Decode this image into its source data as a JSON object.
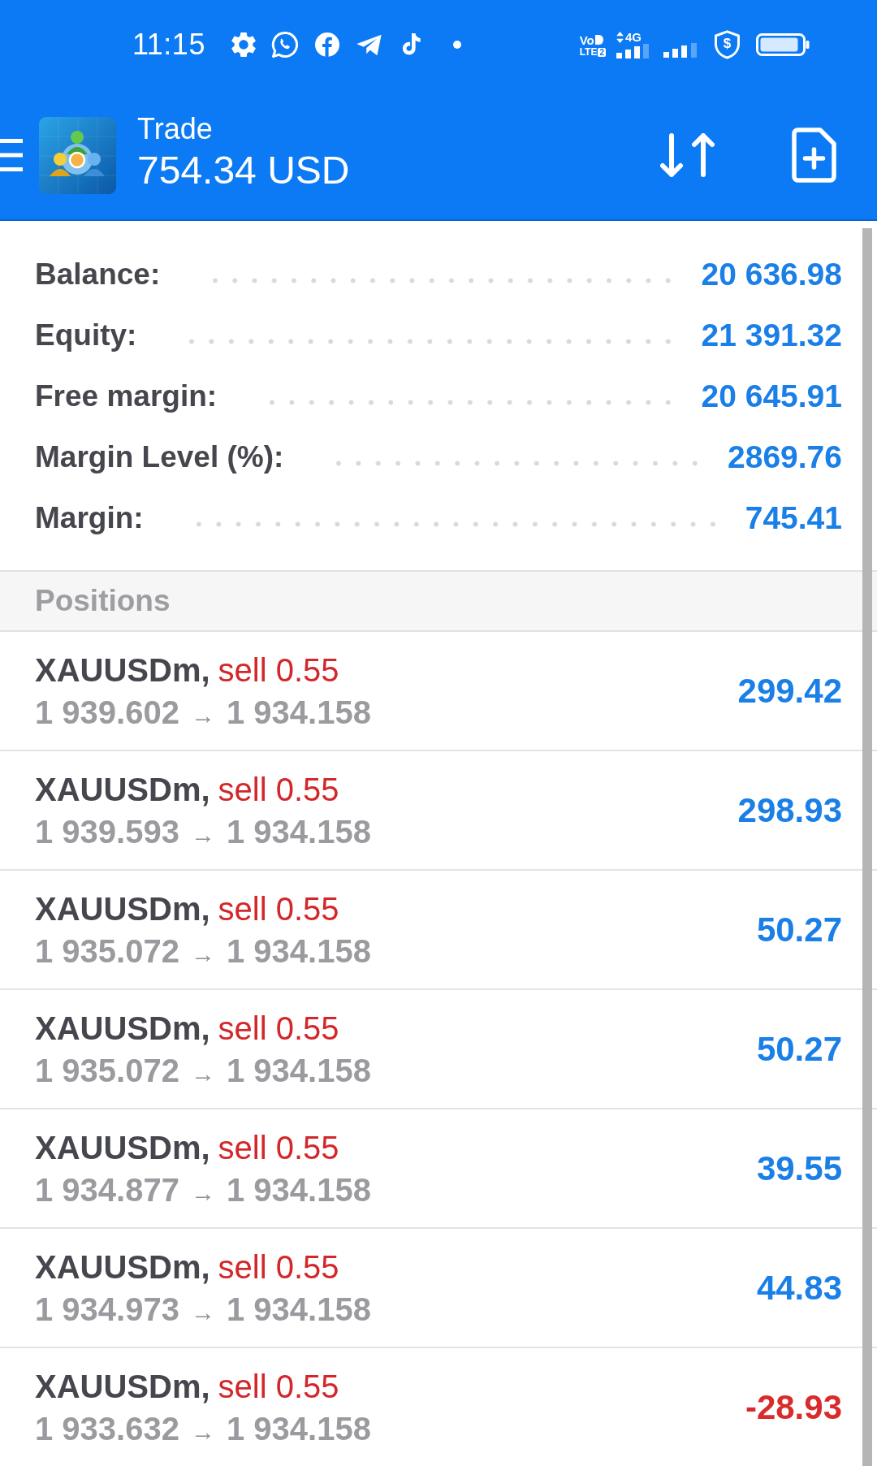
{
  "status_bar": {
    "time": "11:15",
    "volte": {
      "top": "Vo",
      "bottom": "LTE",
      "sim": "2"
    },
    "network_type": "4G",
    "shield_mark": "$"
  },
  "header": {
    "title": "Trade",
    "amount": "754.34 USD"
  },
  "summary": [
    {
      "label": "Balance:",
      "value": "20 636.98"
    },
    {
      "label": "Equity:",
      "value": "21 391.32"
    },
    {
      "label": "Free margin:",
      "value": "20 645.91"
    },
    {
      "label": "Margin Level (%):",
      "value": "2869.76"
    },
    {
      "label": "Margin:",
      "value": "745.41"
    }
  ],
  "positions": {
    "title": "Positions",
    "items": [
      {
        "symbol": "XAUUSDm,",
        "order": "sell 0.55",
        "open_price": "1 939.602",
        "arrow": "→",
        "current_price": "1 934.158",
        "profit": "299.42",
        "color": "#1a7fe6"
      },
      {
        "symbol": "XAUUSDm,",
        "order": "sell 0.55",
        "open_price": "1 939.593",
        "arrow": "→",
        "current_price": "1 934.158",
        "profit": "298.93",
        "color": "#1a7fe6"
      },
      {
        "symbol": "XAUUSDm,",
        "order": "sell 0.55",
        "open_price": "1 935.072",
        "arrow": "→",
        "current_price": "1 934.158",
        "profit": "50.27",
        "color": "#1a7fe6"
      },
      {
        "symbol": "XAUUSDm,",
        "order": "sell 0.55",
        "open_price": "1 935.072",
        "arrow": "→",
        "current_price": "1 934.158",
        "profit": "50.27",
        "color": "#1a7fe6"
      },
      {
        "symbol": "XAUUSDm,",
        "order": "sell 0.55",
        "open_price": "1 934.877",
        "arrow": "→",
        "current_price": "1 934.158",
        "profit": "39.55",
        "color": "#1a7fe6"
      },
      {
        "symbol": "XAUUSDm,",
        "order": "sell 0.55",
        "open_price": "1 934.973",
        "arrow": "→",
        "current_price": "1 934.158",
        "profit": "44.83",
        "color": "#1a7fe6"
      },
      {
        "symbol": "XAUUSDm,",
        "order": "sell 0.55",
        "open_price": "1 933.632",
        "arrow": "→",
        "current_price": "1 934.158",
        "profit": "-28.93",
        "color": "#d92b2b"
      }
    ]
  }
}
